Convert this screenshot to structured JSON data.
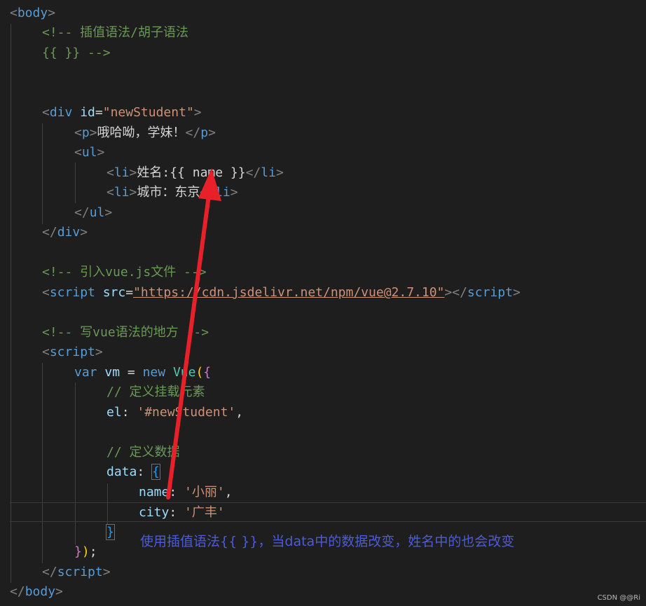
{
  "code": {
    "body_open": "body",
    "comment_interp": "<!-- 插值语法/胡子语法",
    "comment_interp2": "{{ }} -->",
    "div_tag": "div",
    "div_attr": "id",
    "div_id_val": "\"newStudent\"",
    "p_tag": "p",
    "p_text": "哦哈呦，学妹！",
    "ul_tag": "ul",
    "li_tag": "li",
    "li1_text": "姓名:",
    "li1_mustache": "{{ name }}",
    "li2_text": "城市：东京",
    "comment_vue": "<!-- 引入vue.js文件 -->",
    "script_tag": "script",
    "script_attr": "src",
    "script_src": "\"https://cdn.jsdelivr.net/npm/vue@2.7.10\"",
    "comment_write": "<!-- 写vue语法的地方 -->",
    "kw_var": "var",
    "id_vm": "vm",
    "op_eq": "=",
    "kw_new": "new",
    "cls_vue": "Vue",
    "comment_el": "// 定义挂载元素",
    "key_el": "el",
    "val_el": "'#newStudent'",
    "comment_data": "// 定义数据",
    "key_data": "data",
    "key_name": "name",
    "val_name": "'小丽'",
    "key_city": "city",
    "val_city": "'广丰'",
    "body_close": "body"
  },
  "annotation": "使用插值语法{{  }}，当data中的数据改变，姓名中的也会改变",
  "watermark": "CSDN @@Ri",
  "colors": {
    "background": "#1e1e1e",
    "tag": "#569cd6",
    "string": "#ce9178",
    "comment": "#6a9955",
    "attribute": "#9cdcfe",
    "annotation": "#4d5bd8",
    "arrow": "#e8202a"
  }
}
